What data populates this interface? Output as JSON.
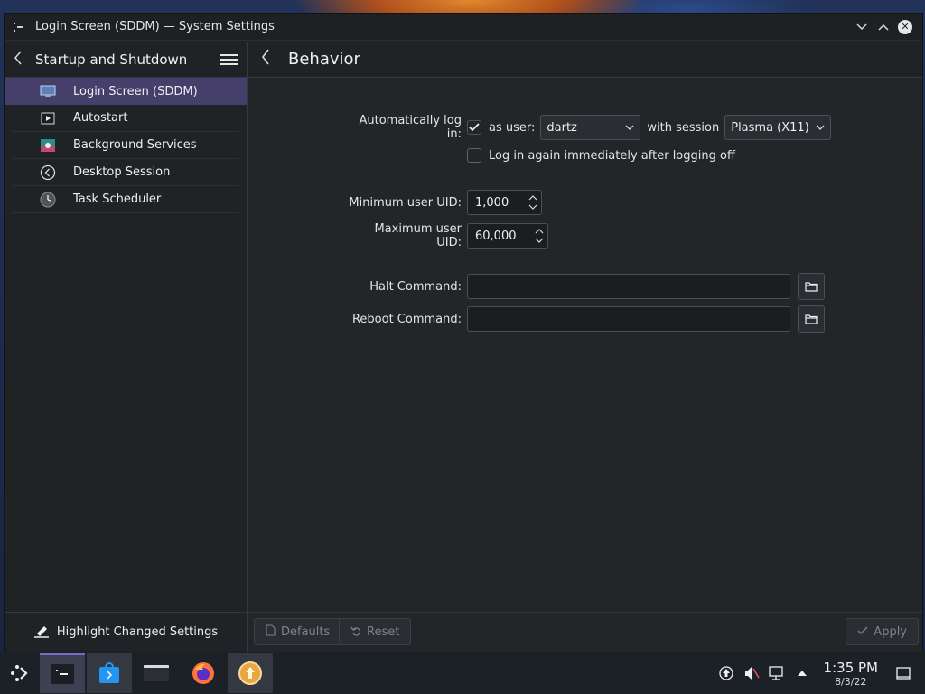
{
  "window": {
    "title": "Login Screen (SDDM) — System Settings"
  },
  "sidebar": {
    "heading": "Startup and Shutdown",
    "items": [
      {
        "label": "Login Screen (SDDM)",
        "icon": "monitor-icon",
        "active": true
      },
      {
        "label": "Autostart",
        "icon": "autostart-icon"
      },
      {
        "label": "Background Services",
        "icon": "services-icon"
      },
      {
        "label": "Desktop Session",
        "icon": "session-icon"
      },
      {
        "label": "Task Scheduler",
        "icon": "clock-icon"
      }
    ],
    "footer_label": "Highlight Changed Settings"
  },
  "main": {
    "page_title": "Behavior",
    "autologin": {
      "label": "Automatically log in:",
      "checked": true,
      "as_user_label": "as user:",
      "user_value": "dartz",
      "with_session_label": "with session",
      "session_value": "Plasma (X11)"
    },
    "relogin": {
      "label": "Log in again immediately after logging off",
      "checked": false
    },
    "min_uid": {
      "label": "Minimum user UID:",
      "value": "1,000"
    },
    "max_uid": {
      "label": "Maximum user UID:",
      "value": "60,000"
    },
    "halt": {
      "label": "Halt Command:",
      "value": ""
    },
    "reboot": {
      "label": "Reboot Command:",
      "value": ""
    },
    "buttons": {
      "defaults": "Defaults",
      "reset": "Reset",
      "apply": "Apply"
    }
  },
  "taskbar": {
    "time": "1:35 PM",
    "date": "8/3/22"
  }
}
